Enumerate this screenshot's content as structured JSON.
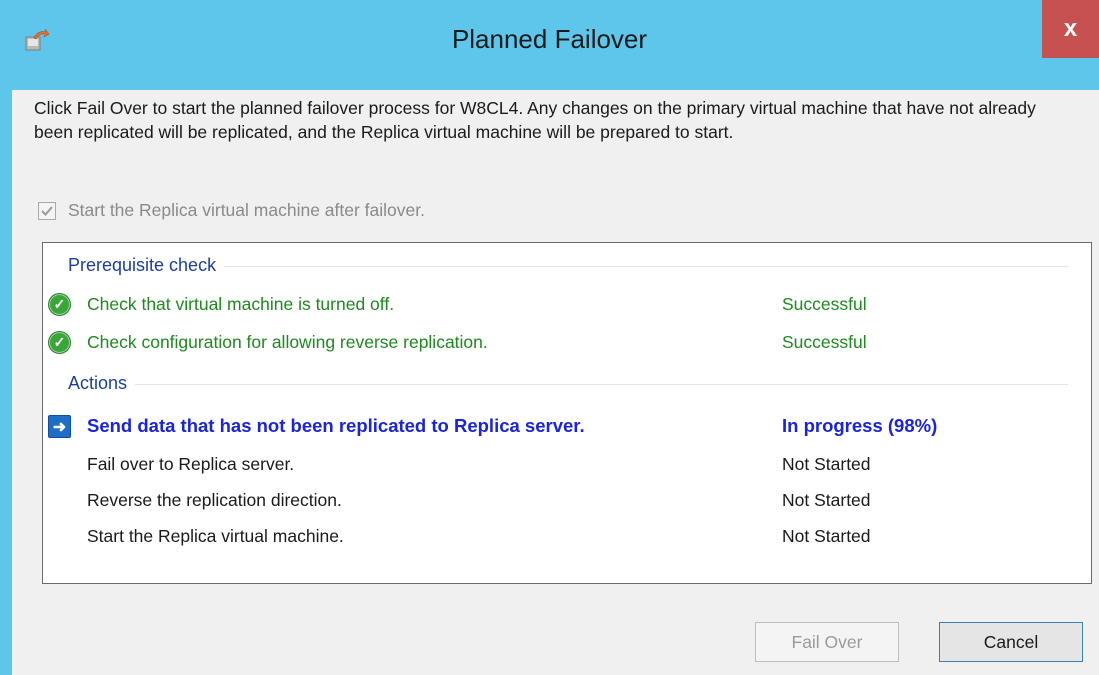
{
  "window": {
    "title": "Planned Failover",
    "close_glyph": "x",
    "icon": "replica-failover-icon"
  },
  "description": "Click Fail Over to start the planned failover process for W8CL4. Any changes on the primary virtual machine that have not already been replicated will be replicated, and the Replica virtual machine will be prepared to start.",
  "start_after_failover": {
    "label": "Start the Replica virtual machine after failover.",
    "checked": true,
    "enabled": false
  },
  "prerequisite": {
    "heading": "Prerequisite check",
    "items": [
      {
        "label": "Check that virtual machine is turned off.",
        "status": "Successful",
        "icon": "check-success-icon"
      },
      {
        "label": "Check configuration for allowing reverse replication.",
        "status": "Successful",
        "icon": "check-success-icon"
      }
    ]
  },
  "actions": {
    "heading": "Actions",
    "items": [
      {
        "label": "Send data that has not been replicated to Replica server.",
        "status": "In progress (98%)",
        "icon": "arrow-right-icon"
      },
      {
        "label": "Fail over to Replica server.",
        "status": "Not Started"
      },
      {
        "label": "Reverse the replication direction.",
        "status": "Not Started"
      },
      {
        "label": "Start the Replica virtual machine.",
        "status": "Not Started"
      }
    ]
  },
  "buttons": {
    "fail_over": "Fail Over",
    "cancel": "Cancel"
  },
  "colors": {
    "titlebar": "#5dc6ea",
    "close": "#c75050",
    "success": "#1e8a1e",
    "active": "#1a24e0",
    "heading": "#1c3fa0"
  }
}
